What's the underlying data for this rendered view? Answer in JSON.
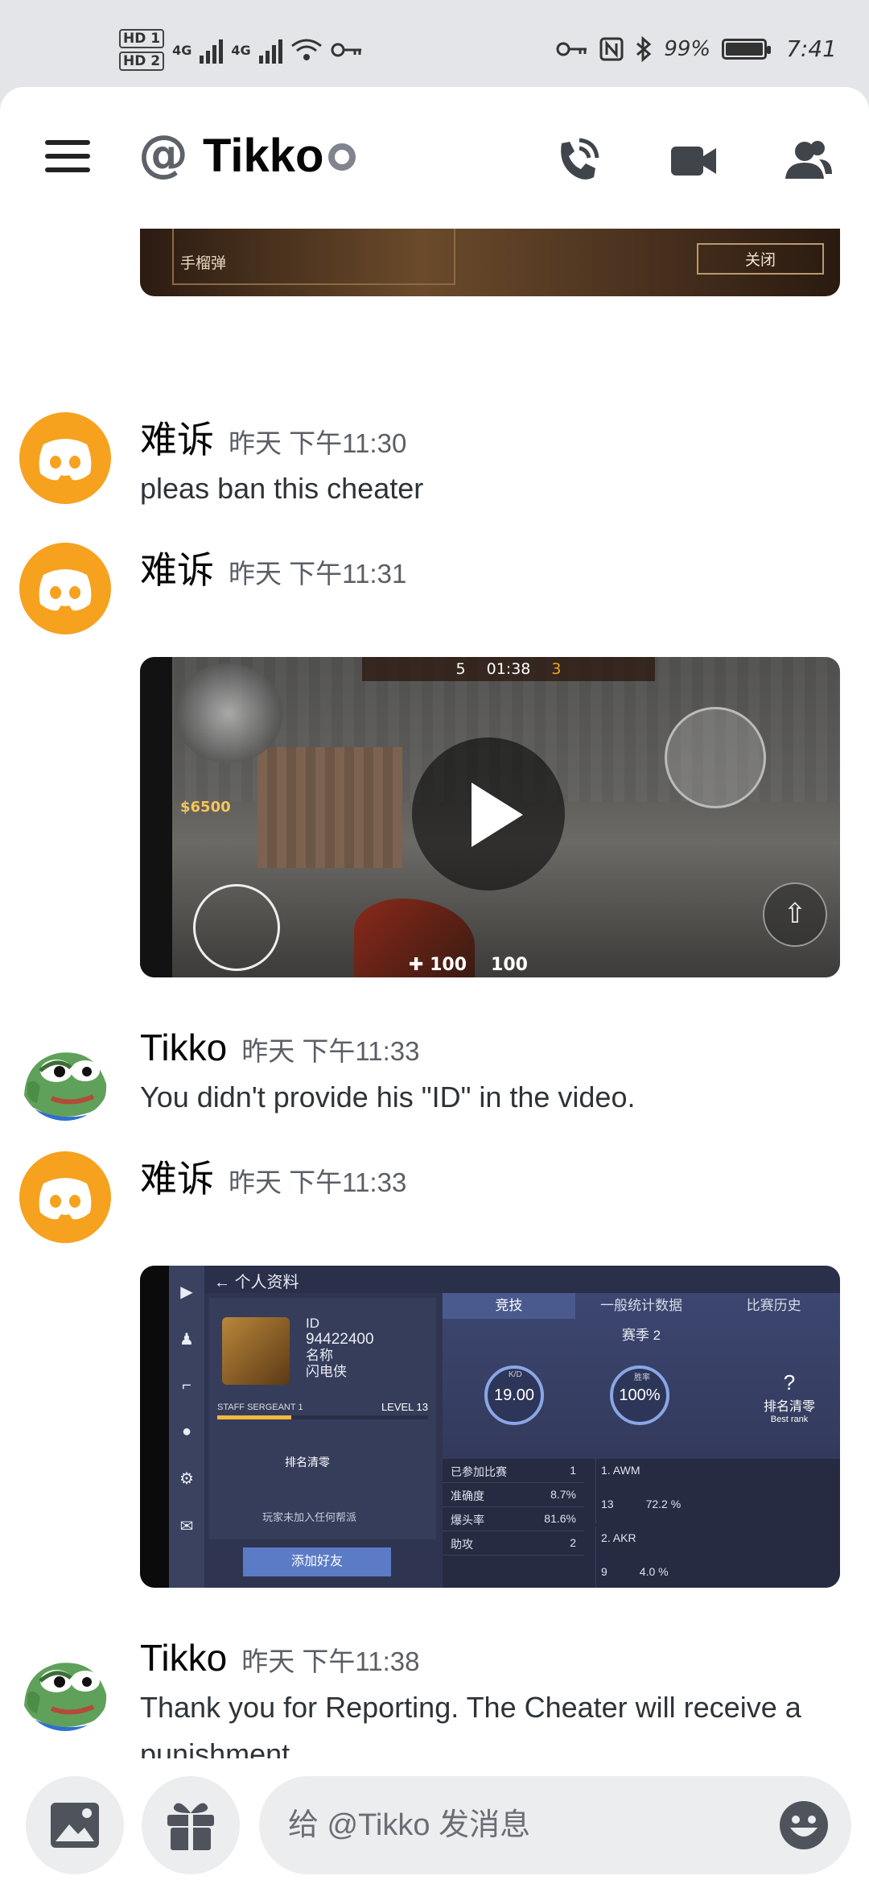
{
  "status_bar": {
    "sim1": "HD 1",
    "sim2": "HD 2",
    "net1": "4G",
    "net2": "4G",
    "battery_pct": "99%",
    "time": "7:41"
  },
  "header": {
    "at_symbol": "@",
    "title": "Tikko"
  },
  "embed_top": {
    "left_label": "手榴弹",
    "right_label": "关闭"
  },
  "messages": [
    {
      "author": "难诉",
      "time": "昨天 下午11:30",
      "text": "pleas ban this cheater"
    },
    {
      "author": "难诉",
      "time": "昨天 下午11:31",
      "text": ""
    },
    {
      "author": "Tikko",
      "time": "昨天 下午11:33",
      "text": "You didn't provide his \"ID\" in the video."
    },
    {
      "author": "难诉",
      "time": "昨天 下午11:33",
      "text": ""
    },
    {
      "author": "Tikko",
      "time": "昨天 下午11:38",
      "text": "Thank you for Reporting. The Cheater will receive a punishment."
    }
  ],
  "video": {
    "score_left": "5",
    "clock": "01:38",
    "score_right": "3",
    "money": "$6500",
    "health": "100",
    "armor": "100"
  },
  "screenshot": {
    "topbar": "个人资料",
    "id_label": "ID",
    "id_value": "94422400",
    "name_label": "名称",
    "name_value": "闪电侠",
    "rank_title": "STAFF SERGEANT 1",
    "level": "LEVEL 13",
    "rank_text": "排名清零",
    "no_team": "玩家未加入任何帮派",
    "add_friend": "添加好友",
    "tabs": [
      "竞技",
      "一般统计数据",
      "比赛历史"
    ],
    "season": "赛季 2",
    "kd_label": "K/D",
    "kd": "19.00",
    "win_label": "胜率",
    "win_rate": "100%",
    "best_rank": "排名清零",
    "best_rank_en": "Best rank",
    "table": [
      {
        "label": "已参加比赛",
        "value": "1"
      },
      {
        "label": "准确度",
        "value": "8.7%"
      },
      {
        "label": "爆头率",
        "value": "81.6%"
      },
      {
        "label": "助攻",
        "value": "2"
      }
    ],
    "weapons": [
      {
        "name": "1. AWM",
        "kills": "13",
        "accuracy": "72.2 %"
      },
      {
        "name": "2. AKR",
        "kills": "9",
        "accuracy": "4.0 %"
      }
    ]
  },
  "composer": {
    "placeholder": "给 @Tikko 发消息"
  },
  "colors": {
    "discord_orange": "#f6a21f",
    "status_gray": "#80848e",
    "timestamp": "#5c5e66"
  }
}
